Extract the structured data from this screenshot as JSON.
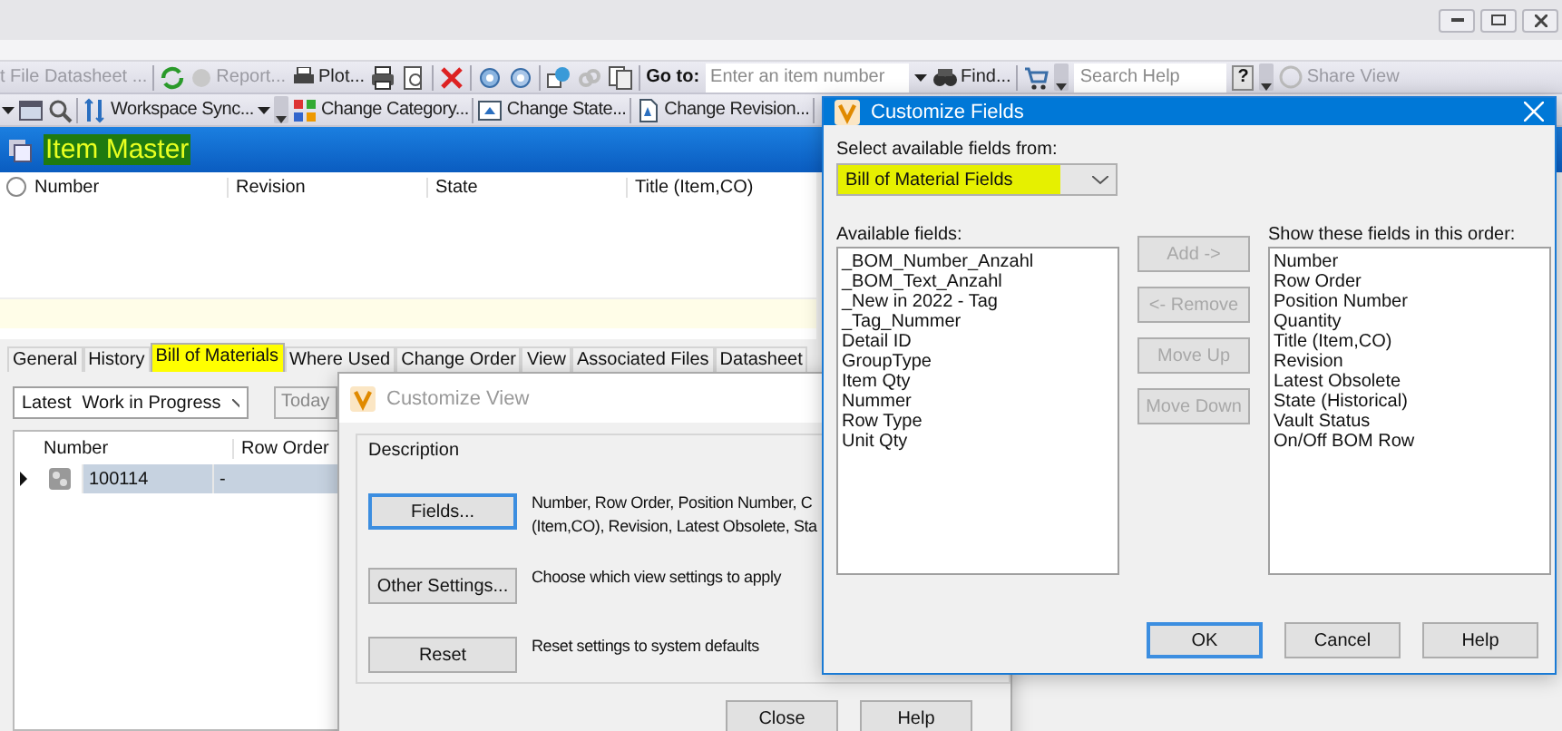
{
  "toolbar_1": {
    "cut_text": "t File Datasheet ...",
    "buttons": [
      {
        "label": "Report...",
        "disabled": true
      },
      {
        "label": "Plot...",
        "disabled": false
      }
    ],
    "goto": {
      "label": "Go to:",
      "placeholder": "Enter an item number"
    },
    "find": "Find...",
    "search": {
      "placeholder": "Search Help"
    },
    "help_key": "?",
    "share": {
      "label": "Share View",
      "disabled": true
    }
  },
  "toolbar_2": {
    "buttons": [
      {
        "label": "Workspace Sync..."
      },
      {
        "label": "Change Category..."
      },
      {
        "label": "Change State..."
      },
      {
        "label": "Change Revision..."
      }
    ]
  },
  "item_master": {
    "title": "Item Master",
    "highlighted": true,
    "columns": [
      "Number",
      "Revision",
      "State",
      "Title (Item,CO)"
    ]
  },
  "tabs": [
    {
      "label": "General",
      "selected": false,
      "highlighted": false
    },
    {
      "label": "History",
      "selected": false,
      "highlighted": false
    },
    {
      "label": "Bill of Materials",
      "selected": true,
      "highlighted": true
    },
    {
      "label": "Where Used",
      "selected": false,
      "highlighted": false
    },
    {
      "label": "Change Order",
      "selected": false,
      "highlighted": false
    },
    {
      "label": "View",
      "selected": false,
      "highlighted": false
    },
    {
      "label": "Associated Files",
      "selected": false,
      "highlighted": false
    },
    {
      "label": "Datasheet",
      "selected": false,
      "highlighted": false
    }
  ],
  "bom": {
    "filter_left": "Latest",
    "filter_value": "Work in Progress",
    "date_button": "Today",
    "columns": [
      "Number",
      "Row Order"
    ],
    "rows": [
      {
        "number": "100114",
        "row_order": "-",
        "selected": true
      }
    ]
  },
  "customize_view": {
    "title": "Customize View",
    "group": "Description",
    "actions": [
      {
        "button": "Fields...",
        "focused": true,
        "description": [
          "Number, Row Order, Position Number, C",
          "(Item,CO), Revision, Latest Obsolete, Sta"
        ]
      },
      {
        "button": "Other Settings...",
        "focused": false,
        "description": [
          "Choose which view settings to apply"
        ]
      },
      {
        "button": "Reset",
        "focused": false,
        "description": [
          "Reset settings to system defaults"
        ]
      }
    ],
    "footer_buttons": [
      "Close",
      "Help"
    ]
  },
  "customize_fields": {
    "title": "Customize Fields",
    "source_label": "Select available fields from:",
    "source": {
      "value": "Bill of Material Fields",
      "highlighted": true
    },
    "available_label": "Available fields:",
    "available": [
      "_BOM_Number_Anzahl",
      "_BOM_Text_Anzahl",
      "_New in 2022 - Tag",
      "_Tag_Nummer",
      "Detail ID",
      "GroupType",
      "Item Qty",
      "Nummer",
      "Row Type",
      "Unit Qty"
    ],
    "actions": [
      {
        "label": "Add ->",
        "disabled": true
      },
      {
        "label": "<- Remove",
        "disabled": true
      },
      {
        "label": "Move Up",
        "disabled": true
      },
      {
        "label": "Move Down",
        "disabled": true
      }
    ],
    "shown_label": "Show these fields in this order:",
    "shown": [
      "Number",
      "Row Order",
      "Position Number",
      "Quantity",
      "Title (Item,CO)",
      "Revision",
      "Latest Obsolete",
      "State (Historical)",
      "Vault Status",
      "On/Off BOM Row"
    ],
    "buttons": [
      {
        "label": "OK",
        "focused": true
      },
      {
        "label": "Cancel",
        "focused": false
      },
      {
        "label": "Help",
        "focused": false
      }
    ]
  }
}
